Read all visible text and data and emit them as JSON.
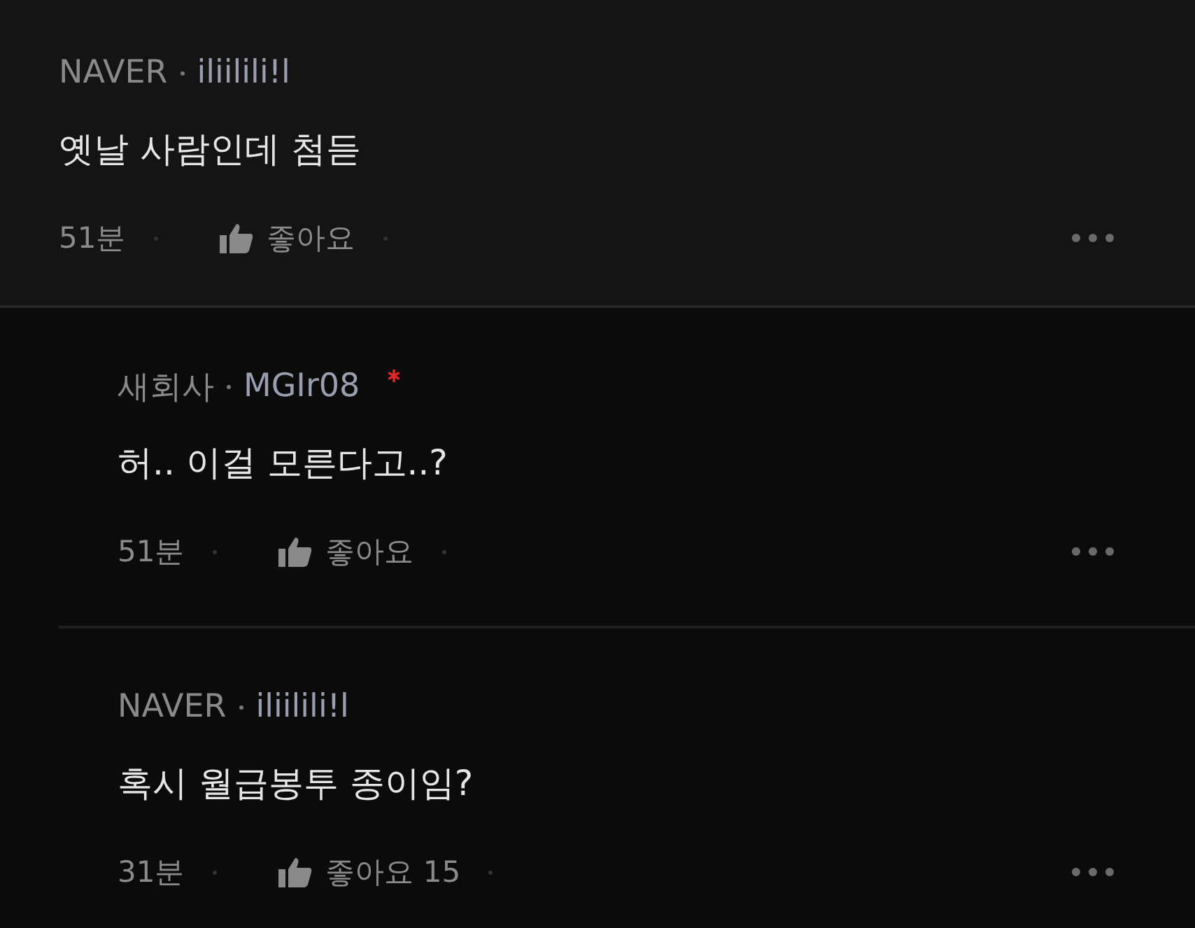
{
  "comments": [
    {
      "kind": "top",
      "source": "NAVER",
      "author": "iliilili!l",
      "marked": false,
      "text": "옛날 사람인데 첨듣",
      "time": "51분",
      "like_label": "좋아요"
    },
    {
      "kind": "reply",
      "source": "새회사",
      "author": "MGIr08",
      "marked": true,
      "text": "허.. 이걸 모른다고..?",
      "time": "51분",
      "like_label": "좋아요"
    },
    {
      "kind": "reply",
      "source": "NAVER",
      "author": "iliilili!l",
      "marked": false,
      "text": "혹시 월급봉투 종이임?",
      "time": "31분",
      "like_label": "좋아요",
      "like_count": "15"
    }
  ]
}
